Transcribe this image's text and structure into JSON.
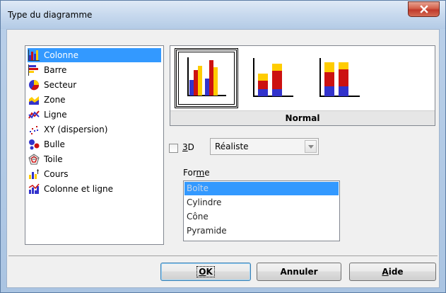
{
  "window": {
    "title": "Type du diagramme"
  },
  "chart_types": [
    {
      "label": "Colonne",
      "icon": "column-chart-icon",
      "selected": true
    },
    {
      "label": "Barre",
      "icon": "bar-chart-icon",
      "selected": false
    },
    {
      "label": "Secteur",
      "icon": "pie-chart-icon",
      "selected": false
    },
    {
      "label": "Zone",
      "icon": "area-chart-icon",
      "selected": false
    },
    {
      "label": "Ligne",
      "icon": "line-chart-icon",
      "selected": false
    },
    {
      "label": "XY (dispersion)",
      "icon": "scatter-chart-icon",
      "selected": false
    },
    {
      "label": "Bulle",
      "icon": "bubble-chart-icon",
      "selected": false
    },
    {
      "label": "Toile",
      "icon": "net-chart-icon",
      "selected": false
    },
    {
      "label": "Cours",
      "icon": "stock-chart-icon",
      "selected": false
    },
    {
      "label": "Colonne et ligne",
      "icon": "column-line-chart-icon",
      "selected": false
    }
  ],
  "variants": {
    "caption": "Normal",
    "selected_index": 0
  },
  "options": {
    "three_d_label_u": "3",
    "three_d_label_rest": "D",
    "three_d_checked": false,
    "scheme_value": "Réaliste",
    "forme_label_pre": "For",
    "forme_label_u": "m",
    "forme_label_post": "e",
    "shapes": [
      "Boîte",
      "Cylindre",
      "Cône",
      "Pyramide"
    ],
    "selected_shape": "Boîte"
  },
  "buttons": {
    "ok_u": "O",
    "ok_rest": "K",
    "cancel": "Annuler",
    "help_u": "A",
    "help_rest": "ide"
  },
  "colors": {
    "selection": "#3399ff",
    "bar_blue": "#3333cc",
    "bar_red": "#cc1111",
    "bar_yellow": "#ffcc00"
  }
}
